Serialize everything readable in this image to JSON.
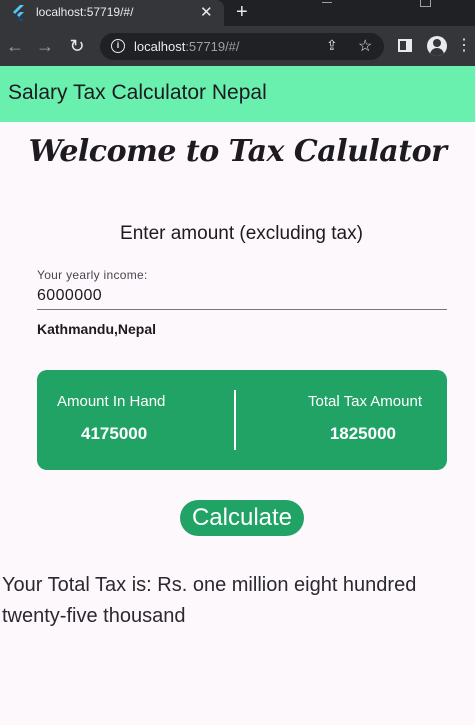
{
  "browser": {
    "tab_title": "localhost:57719/#/",
    "tab_close": "✕",
    "new_tab": "+",
    "url_host": "localhost",
    "url_rest": ":57719/#/"
  },
  "app": {
    "title": "Salary Tax Calculator Nepal",
    "welcome": "Welcome to Tax Calulator",
    "subtitle": "Enter amount (excluding tax)",
    "income_label": "Your yearly income:",
    "income_value": "6000000",
    "location": "Kathmandu,Nepal",
    "card": {
      "in_hand_label": "Amount In Hand",
      "in_hand_value": "4175000",
      "tax_label": "Total Tax Amount",
      "tax_value": "1825000"
    },
    "calculate_label": "Calculate",
    "result": "Your Total Tax is: Rs. one million eight hundred twenty-five thousand"
  },
  "colors": {
    "appbar": "#69f0ae",
    "accent": "#21a366",
    "background": "#fdf8fc"
  }
}
